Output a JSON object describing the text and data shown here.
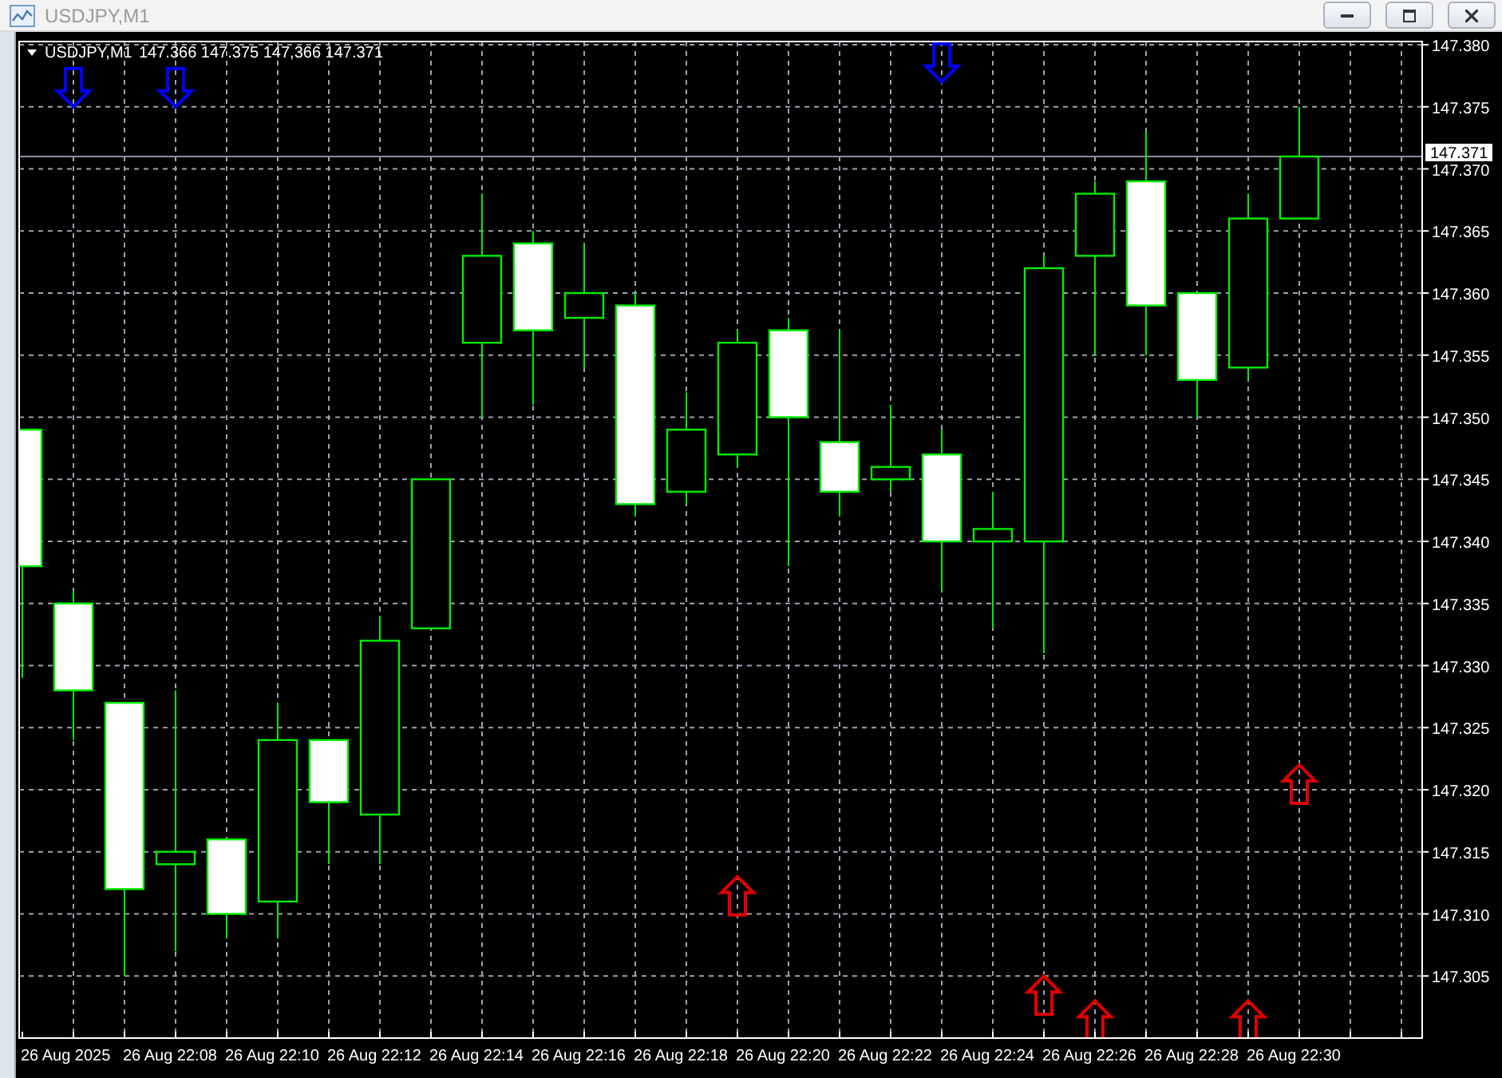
{
  "window": {
    "title": "USDJPY,M1"
  },
  "chart": {
    "symbol": "USDJPY,M1",
    "quote": "147.366 147.375 147,366 147.371",
    "current_price_label": "147.371",
    "price_axis_labels": [
      "147.380",
      "147.375",
      "147.370",
      "147.365",
      "147.360",
      "147.355",
      "147.350",
      "147.345",
      "147.340",
      "147.335",
      "147.330",
      "147.325",
      "147.320",
      "147.315",
      "147.310",
      "147.305"
    ],
    "time_axis_labels": [
      "26 Aug 2025",
      "26 Aug 22:08",
      "26 Aug 22:10",
      "26 Aug 22:12",
      "26 Aug 22:14",
      "26 Aug 22:16",
      "26 Aug 22:18",
      "26 Aug 22:20",
      "26 Aug 22:22",
      "26 Aug 22:24",
      "26 Aug 22:26",
      "26 Aug 22:28",
      "26 Aug 22:30"
    ]
  }
}
